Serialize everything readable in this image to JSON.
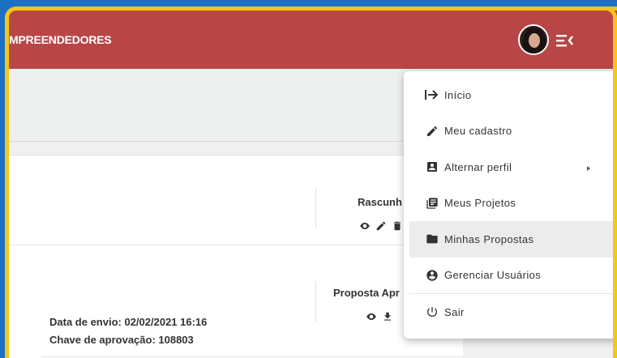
{
  "header": {
    "brand": "MPREENDEDORES"
  },
  "rows": [
    {
      "status": "Rascunh",
      "envio_label": "",
      "chave_label": ""
    },
    {
      "status": "Proposta Apr",
      "envio": "Data de envio: 02/02/2021 16:16",
      "chave": "Chave de aprovação: 108803"
    }
  ],
  "menu": {
    "items": [
      {
        "label": "Início",
        "icon": "login-arrow-icon"
      },
      {
        "label": "Meu cadastro",
        "icon": "pencil-icon"
      },
      {
        "label": "Alternar perfil",
        "icon": "account-box-icon"
      },
      {
        "label": "Meus Projetos",
        "icon": "library-books-icon"
      },
      {
        "label": "Minhas Propostas",
        "icon": "folder-icon"
      },
      {
        "label": "Gerenciar Usuários",
        "icon": "account-circle-icon"
      },
      {
        "label": "Sair",
        "icon": "power-icon"
      }
    ]
  },
  "colors": {
    "topbar": "#b94646",
    "frame": "#f5c518",
    "background": "#1d6fc4"
  }
}
